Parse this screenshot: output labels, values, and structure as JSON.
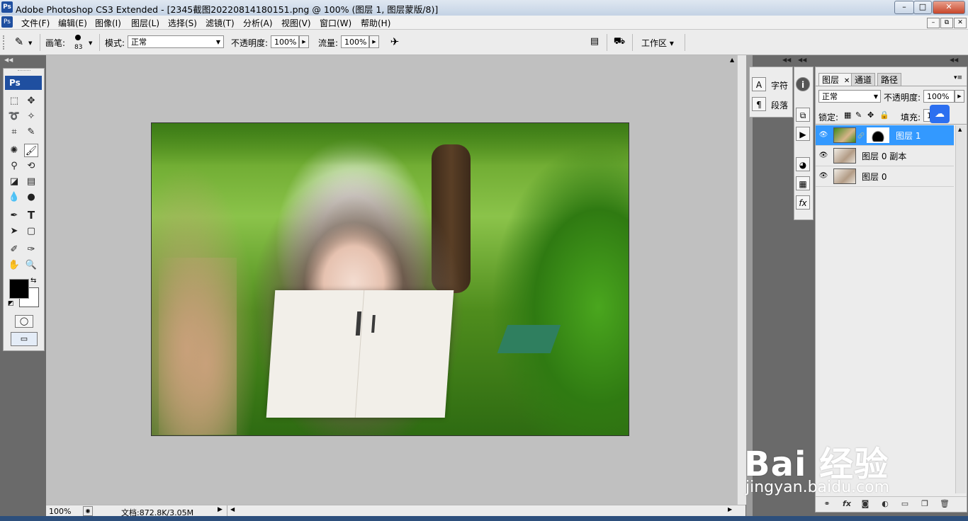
{
  "window": {
    "title": "Adobe Photoshop CS3 Extended - [2345截图20220814180151.png @ 100% (图层 1, 图层蒙版/8)]",
    "logo": "Ps",
    "controls": [
      "–",
      "□",
      "✕"
    ]
  },
  "menubar": {
    "items": [
      "文件(F)",
      "编辑(E)",
      "图像(I)",
      "图层(L)",
      "选择(S)",
      "滤镜(T)",
      "分析(A)",
      "视图(V)",
      "窗口(W)",
      "帮助(H)"
    ],
    "mdi_controls": [
      "–",
      "⧉",
      "✕"
    ]
  },
  "options": {
    "brush_label": "画笔:",
    "brush_size": "83",
    "mode_label": "模式:",
    "mode_value": "正常",
    "opacity_label": "不透明度:",
    "opacity_value": "100%",
    "flow_label": "流量:",
    "flow_value": "100%",
    "workspace_label": "工作区 ▾"
  },
  "toolbox": {
    "logo": "Ps",
    "tools": [
      {
        "name": "marquee-tool",
        "glyph": "⬚"
      },
      {
        "name": "move-tool",
        "glyph": "✥"
      },
      {
        "name": "lasso-tool",
        "glyph": "➰"
      },
      {
        "name": "magic-wand-tool",
        "glyph": "✧"
      },
      {
        "name": "crop-tool",
        "glyph": "⌗"
      },
      {
        "name": "slice-tool",
        "glyph": "✎"
      },
      {
        "name": "healing-brush-tool",
        "glyph": "✺"
      },
      {
        "name": "brush-tool",
        "glyph": "🖌"
      },
      {
        "name": "clone-stamp-tool",
        "glyph": "⚲"
      },
      {
        "name": "history-brush-tool",
        "glyph": "⟲"
      },
      {
        "name": "eraser-tool",
        "glyph": "◪"
      },
      {
        "name": "gradient-tool",
        "glyph": "▤"
      },
      {
        "name": "blur-tool",
        "glyph": "💧"
      },
      {
        "name": "dodge-tool",
        "glyph": "●"
      },
      {
        "name": "pen-tool",
        "glyph": "✒"
      },
      {
        "name": "type-tool",
        "glyph": "T"
      },
      {
        "name": "path-selection-tool",
        "glyph": "➤"
      },
      {
        "name": "shape-tool",
        "glyph": "▢"
      },
      {
        "name": "notes-tool",
        "glyph": "✐"
      },
      {
        "name": "eyedropper-tool",
        "glyph": "✑"
      },
      {
        "name": "hand-tool",
        "glyph": "✋"
      },
      {
        "name": "zoom-tool",
        "glyph": "🔍"
      }
    ],
    "foreground_color": "#000000",
    "background_color": "#ffffff"
  },
  "status": {
    "zoom": "100%",
    "doc_info": "文档:872.8K/3.05M"
  },
  "dock": {
    "character_label": "字符",
    "paragraph_label": "段落"
  },
  "layers": {
    "tabs": [
      "图层",
      "通道",
      "路径"
    ],
    "blend_mode": "正常",
    "opacity_label": "不透明度:",
    "opacity_value": "100%",
    "lock_label": "锁定:",
    "fill_label": "填充:",
    "fill_value": "1",
    "items": [
      {
        "name": "图层 1",
        "selected": true
      },
      {
        "name": "图层 0 副本",
        "selected": false
      },
      {
        "name": "图层 0",
        "selected": false
      }
    ],
    "footer_icons": [
      "link-icon",
      "fx-icon",
      "mask-icon",
      "adjustment-icon",
      "group-icon",
      "new-layer-icon",
      "trash-icon"
    ]
  },
  "watermark": {
    "main": "Bai 经验",
    "sub": "jingyan.baidu.com"
  },
  "colors": {
    "selection": "#3399ff",
    "ps_blue": "#1f4fa0"
  }
}
